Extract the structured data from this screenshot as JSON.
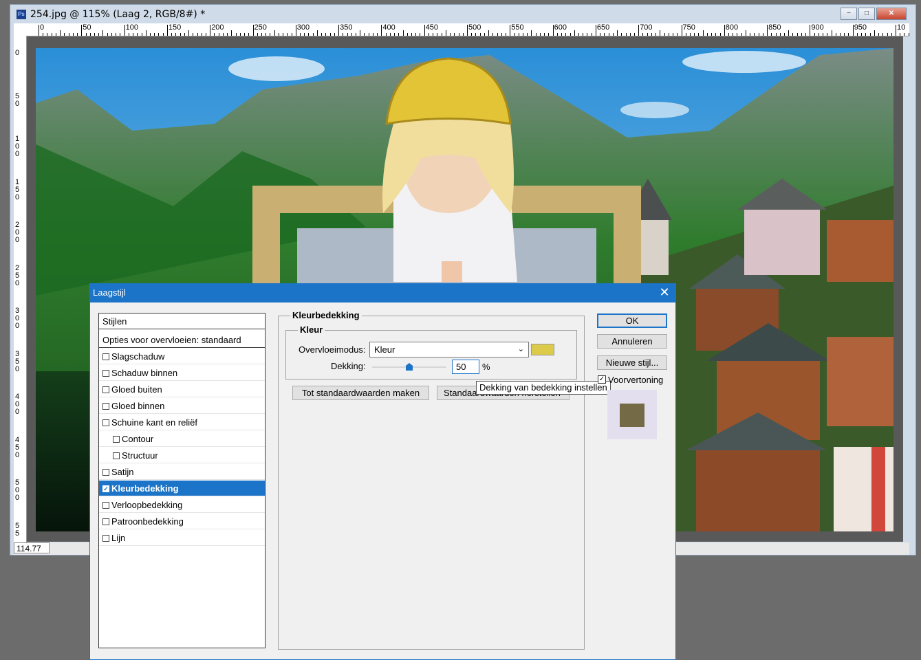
{
  "document": {
    "title": "254.jpg @ 115% (Laag 2, RGB/8#) *",
    "zoom": "114.77",
    "ruler_top_labels": [
      "0",
      "50",
      "100",
      "150",
      "200",
      "250",
      "300",
      "350",
      "400",
      "450",
      "500",
      "550",
      "600",
      "650",
      "700",
      "750",
      "800",
      "850",
      "900",
      "950",
      "10"
    ],
    "ruler_left_labels": [
      "0",
      "5\n0",
      "1\n0\n0",
      "1\n5\n0",
      "2\n0\n0",
      "2\n5\n0",
      "3\n0\n0",
      "3\n5\n0",
      "4\n0\n0",
      "4\n5\n0",
      "5\n0\n0",
      "5\n5"
    ]
  },
  "dialog": {
    "title": "Laagstijl",
    "styles_header": "Stijlen",
    "blend_options": "Opties voor overvloeien: standaard",
    "style_items": [
      {
        "label": "Slagschaduw",
        "checked": false,
        "indent": false,
        "selected": false
      },
      {
        "label": "Schaduw binnen",
        "checked": false,
        "indent": false,
        "selected": false
      },
      {
        "label": "Gloed buiten",
        "checked": false,
        "indent": false,
        "selected": false
      },
      {
        "label": "Gloed binnen",
        "checked": false,
        "indent": false,
        "selected": false
      },
      {
        "label": "Schuine kant en reliëf",
        "checked": false,
        "indent": false,
        "selected": false
      },
      {
        "label": "Contour",
        "checked": false,
        "indent": true,
        "selected": false
      },
      {
        "label": "Structuur",
        "checked": false,
        "indent": true,
        "selected": false
      },
      {
        "label": "Satijn",
        "checked": false,
        "indent": false,
        "selected": false
      },
      {
        "label": "Kleurbedekking",
        "checked": true,
        "indent": false,
        "selected": true
      },
      {
        "label": "Verloopbedekking",
        "checked": false,
        "indent": false,
        "selected": false
      },
      {
        "label": "Patroonbedekking",
        "checked": false,
        "indent": false,
        "selected": false
      },
      {
        "label": "Lijn",
        "checked": false,
        "indent": false,
        "selected": false
      }
    ],
    "section_title": "Kleurbedekking",
    "group_title": "Kleur",
    "blend_mode_label": "Overvloeimodus:",
    "blend_mode_value": "Kleur",
    "overlay_color": "#dccb4a",
    "opacity_label": "Dekking:",
    "opacity_value": "50",
    "opacity_unit": "%",
    "opacity_fraction": 0.5,
    "reset_default_button": "Tot standaardwaarden maken",
    "restore_default_button": "Standaardwaarden herstellen",
    "tooltip": "Dekking van bedekking instellen",
    "ok_button": "OK",
    "cancel_button": "Annuleren",
    "new_style_button": "Nieuwe stijl...",
    "preview_label": "Voorvertoning",
    "preview_checked": true,
    "preview_color": "#756a46",
    "accent_color": "#1b74c8"
  }
}
